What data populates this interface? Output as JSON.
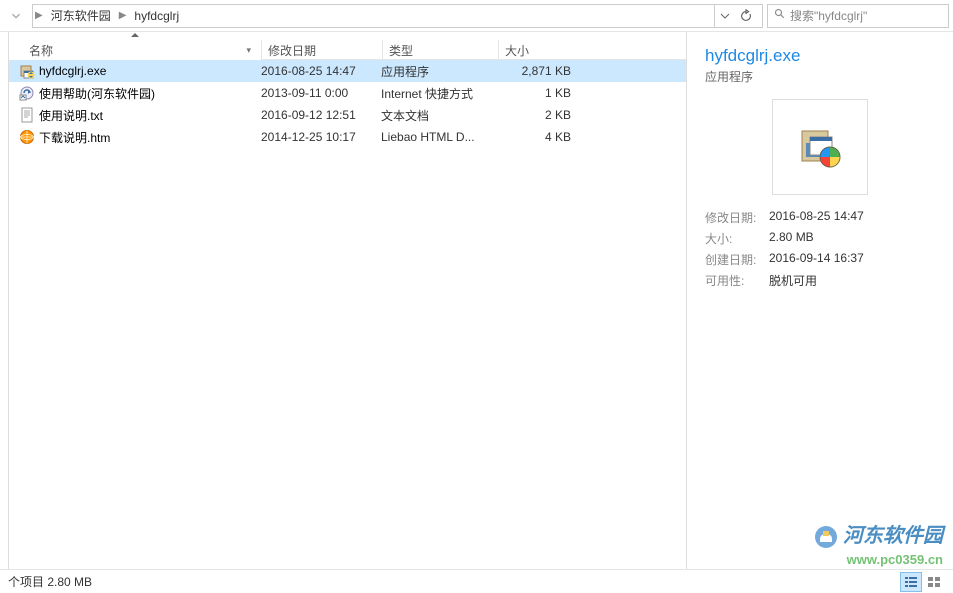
{
  "toolbar": {
    "breadcrumb": [
      "河东软件园",
      "hyfdcglrj"
    ],
    "search_placeholder": "搜索\"hyfdcglrj\""
  },
  "columns": {
    "name": "名称",
    "date": "修改日期",
    "type": "类型",
    "size": "大小"
  },
  "files": [
    {
      "icon": "installer",
      "name": "hyfdcglrj.exe",
      "date": "2016-08-25 14:47",
      "type": "应用程序",
      "size": "2,871 KB",
      "selected": true
    },
    {
      "icon": "shortcut",
      "name": "使用帮助(河东软件园)",
      "date": "2013-09-11 0:00",
      "type": "Internet 快捷方式",
      "size": "1 KB",
      "selected": false
    },
    {
      "icon": "txt",
      "name": "使用说明.txt",
      "date": "2016-09-12 12:51",
      "type": "文本文档",
      "size": "2 KB",
      "selected": false
    },
    {
      "icon": "htm",
      "name": "下载说明.htm",
      "date": "2014-12-25 10:17",
      "type": "Liebao HTML D...",
      "size": "4 KB",
      "selected": false
    }
  ],
  "preview": {
    "title": "hyfdcglrj.exe",
    "subtitle": "应用程序",
    "meta": [
      {
        "label": "修改日期:",
        "value": "2016-08-25 14:47"
      },
      {
        "label": "大小:",
        "value": "2.80 MB"
      },
      {
        "label": "创建日期:",
        "value": "2016-09-14 16:37"
      },
      {
        "label": "可用性:",
        "value": "脱机可用"
      }
    ]
  },
  "status": {
    "text": "个项目  2.80 MB"
  },
  "watermark": {
    "cn": "河东软件园",
    "url": "www.pc0359.cn"
  }
}
